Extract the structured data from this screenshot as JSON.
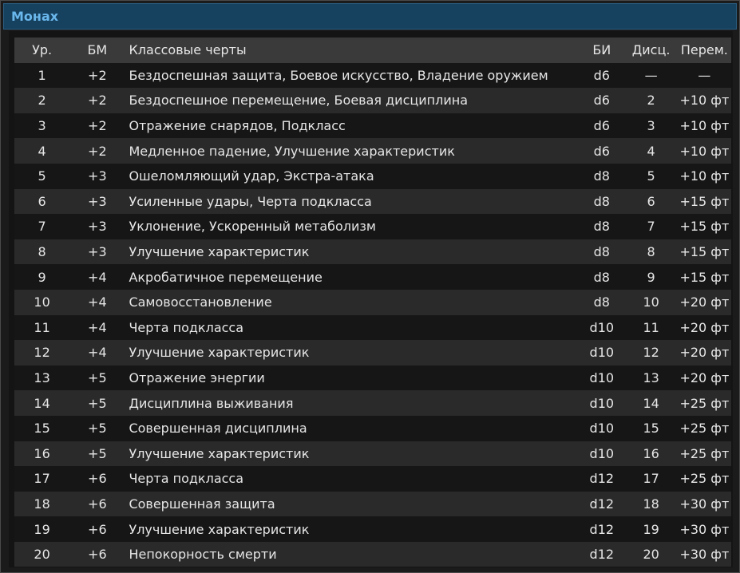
{
  "window": {
    "title": "Монах"
  },
  "table": {
    "headers": {
      "level": "Ур.",
      "prof_bonus": "БМ",
      "features": "Классовые черты",
      "martial_die": "БИ",
      "discipline": "Дисц.",
      "movement": "Перем."
    },
    "rows": [
      {
        "level": "1",
        "prof_bonus": "+2",
        "features": "Бездоспешная защита, Боевое искусство, Владение оружием",
        "martial_die": "d6",
        "discipline": "—",
        "movement": "—"
      },
      {
        "level": "2",
        "prof_bonus": "+2",
        "features": "Бездоспешное перемещение, Боевая дисциплина",
        "martial_die": "d6",
        "discipline": "2",
        "movement": "+10 фт"
      },
      {
        "level": "3",
        "prof_bonus": "+2",
        "features": "Отражение снарядов, Подкласс",
        "martial_die": "d6",
        "discipline": "3",
        "movement": "+10 фт"
      },
      {
        "level": "4",
        "prof_bonus": "+2",
        "features": "Медленное падение, Улучшение характеристик",
        "martial_die": "d6",
        "discipline": "4",
        "movement": "+10 фт"
      },
      {
        "level": "5",
        "prof_bonus": "+3",
        "features": "Ошеломляющий удар, Экстра-атака",
        "martial_die": "d8",
        "discipline": "5",
        "movement": "+10 фт"
      },
      {
        "level": "6",
        "prof_bonus": "+3",
        "features": "Усиленные удары, Черта подкласса",
        "martial_die": "d8",
        "discipline": "6",
        "movement": "+15 фт"
      },
      {
        "level": "7",
        "prof_bonus": "+3",
        "features": "Уклонение, Ускоренный метаболизм",
        "martial_die": "d8",
        "discipline": "7",
        "movement": "+15 фт"
      },
      {
        "level": "8",
        "prof_bonus": "+3",
        "features": "Улучшение характеристик",
        "martial_die": "d8",
        "discipline": "8",
        "movement": "+15 фт"
      },
      {
        "level": "9",
        "prof_bonus": "+4",
        "features": "Акробатичное перемещение",
        "martial_die": "d8",
        "discipline": "9",
        "movement": "+15 фт"
      },
      {
        "level": "10",
        "prof_bonus": "+4",
        "features": "Самовосстановление",
        "martial_die": "d8",
        "discipline": "10",
        "movement": "+20 фт"
      },
      {
        "level": "11",
        "prof_bonus": "+4",
        "features": "Черта подкласса",
        "martial_die": "d10",
        "discipline": "11",
        "movement": "+20 фт"
      },
      {
        "level": "12",
        "prof_bonus": "+4",
        "features": "Улучшение характеристик",
        "martial_die": "d10",
        "discipline": "12",
        "movement": "+20 фт"
      },
      {
        "level": "13",
        "prof_bonus": "+5",
        "features": "Отражение энергии",
        "martial_die": "d10",
        "discipline": "13",
        "movement": "+20 фт"
      },
      {
        "level": "14",
        "prof_bonus": "+5",
        "features": "Дисциплина выживания",
        "martial_die": "d10",
        "discipline": "14",
        "movement": "+25 фт"
      },
      {
        "level": "15",
        "prof_bonus": "+5",
        "features": "Совершенная дисциплина",
        "martial_die": "d10",
        "discipline": "15",
        "movement": "+25 фт"
      },
      {
        "level": "16",
        "prof_bonus": "+5",
        "features": "Улучшение характеристик",
        "martial_die": "d10",
        "discipline": "16",
        "movement": "+25 фт"
      },
      {
        "level": "17",
        "prof_bonus": "+6",
        "features": "Черта подкласса",
        "martial_die": "d12",
        "discipline": "17",
        "movement": "+25 фт"
      },
      {
        "level": "18",
        "prof_bonus": "+6",
        "features": "Совершенная защита",
        "martial_die": "d12",
        "discipline": "18",
        "movement": "+30 фт"
      },
      {
        "level": "19",
        "prof_bonus": "+6",
        "features": "Улучшение характеристик",
        "martial_die": "d12",
        "discipline": "19",
        "movement": "+30 фт"
      },
      {
        "level": "20",
        "prof_bonus": "+6",
        "features": "Непокорность смерти",
        "martial_die": "d12",
        "discipline": "20",
        "movement": "+30 фт"
      }
    ]
  },
  "colors": {
    "title_bar_bg": "#16415f",
    "title_text": "#6ab7ec",
    "header_row_bg": "#3a3a3a",
    "row_even_bg": "#2a2a2a",
    "row_odd_bg": "#161616",
    "text": "#e6e6e6"
  }
}
